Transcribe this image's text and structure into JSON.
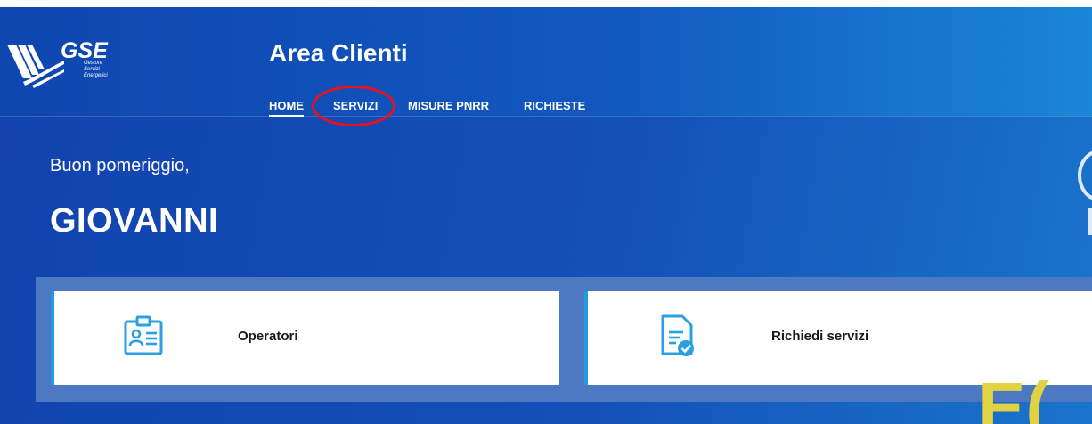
{
  "logo": {
    "wordmark": "GSE",
    "sub_lines": [
      "Gestore",
      "Servizi",
      "Energetici"
    ]
  },
  "header": {
    "title": "Area Clienti"
  },
  "nav": {
    "items": [
      {
        "label": "HOME"
      },
      {
        "label": "SERVIZI"
      },
      {
        "label": "MISURE PNRR"
      },
      {
        "label": "RICHIESTE"
      }
    ]
  },
  "welcome": {
    "greeting": "Buon pomeriggio,",
    "user_name": "GIOVANNI"
  },
  "cards": [
    {
      "label": "Operatori",
      "icon": "id-card-icon"
    },
    {
      "label": "Richiedi servizi",
      "icon": "document-check-icon"
    }
  ],
  "colors": {
    "primary_blue": "#1449b5",
    "card_accent": "#1e9be3",
    "icon_blue": "#2aa0e0",
    "highlight_red": "#e8101e",
    "deco_yellow": "#e1d241"
  }
}
